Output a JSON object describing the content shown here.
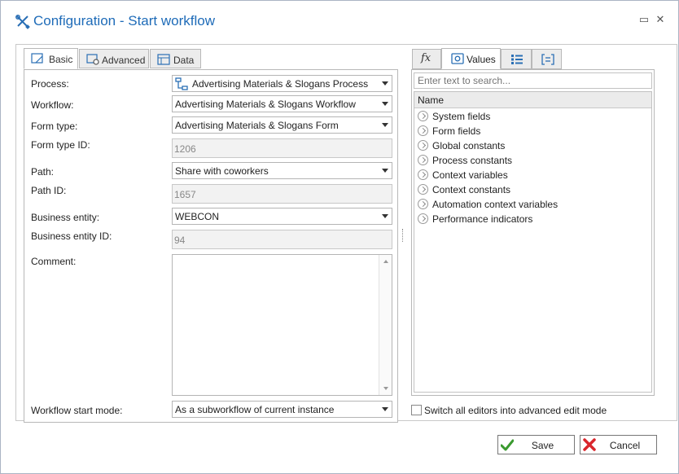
{
  "window": {
    "title": "Configuration - Start workflow",
    "minimize_glyph": "▭",
    "close_glyph": "✕"
  },
  "left_tabs": [
    {
      "label": "Basic",
      "icon": "basic-tab-icon",
      "active": true
    },
    {
      "label": "Advanced",
      "icon": "advanced-tab-icon",
      "active": false
    },
    {
      "label": "Data",
      "icon": "data-tab-icon",
      "active": false
    }
  ],
  "form": {
    "process": {
      "label": "Process:",
      "value": "Advertising Materials & Slogans Process"
    },
    "workflow": {
      "label": "Workflow:",
      "value": "Advertising Materials & Slogans Workflow"
    },
    "form_type": {
      "label": "Form type:",
      "value": "Advertising Materials & Slogans Form"
    },
    "form_type_id": {
      "label": "Form type ID:",
      "value": "1206"
    },
    "path": {
      "label": "Path:",
      "value": "Share with coworkers"
    },
    "path_id": {
      "label": "Path ID:",
      "value": "1657"
    },
    "business_entity": {
      "label": "Business entity:",
      "value": "WEBCON"
    },
    "business_entity_id": {
      "label": "Business entity ID:",
      "value": "94"
    },
    "comment": {
      "label": "Comment:",
      "value": ""
    },
    "start_mode": {
      "label": "Workflow start mode:",
      "value": "As a subworkflow of current instance"
    }
  },
  "right_tabs": [
    {
      "label": "",
      "icon": "function-fx-icon",
      "active": false
    },
    {
      "label": "Values",
      "icon": "values-icon",
      "active": true
    },
    {
      "label": "",
      "icon": "list-icon",
      "active": false
    },
    {
      "label": "",
      "icon": "bracket-icon",
      "active": false
    }
  ],
  "values": {
    "search_placeholder": "Enter text to search...",
    "column_header": "Name",
    "items": [
      "System fields",
      "Form fields",
      "Global constants",
      "Process constants",
      "Context variables",
      "Context constants",
      "Automation context variables",
      "Performance indicators"
    ]
  },
  "advanced_mode": {
    "label": "Switch all editors into advanced edit mode",
    "checked": false
  },
  "buttons": {
    "save": "Save",
    "cancel": "Cancel"
  },
  "colors": {
    "title": "#1e6bb8",
    "save_icon": "#3a9a2f",
    "cancel_icon": "#d9262c",
    "icon_blue": "#2a6fb5"
  }
}
